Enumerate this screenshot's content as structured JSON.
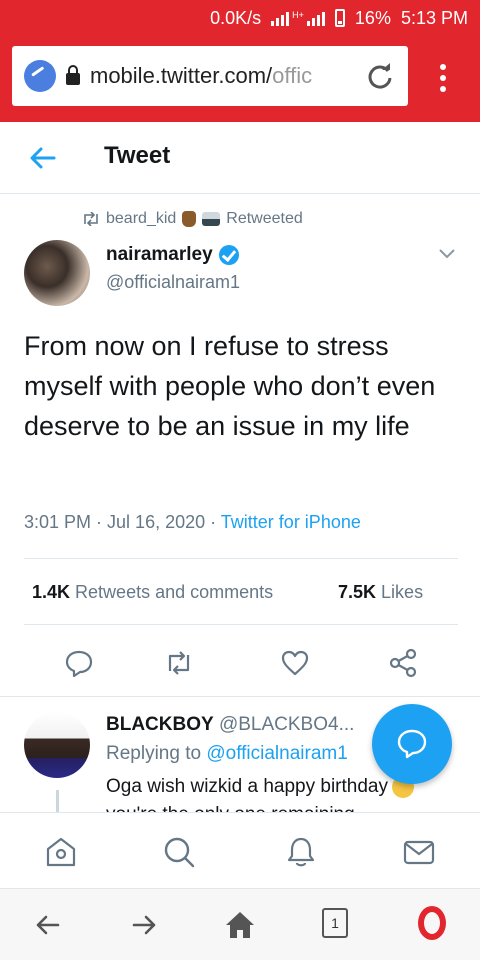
{
  "status_bar": {
    "network_speed": "0.0K/s",
    "network_type": "H+",
    "battery": "16%",
    "time": "5:13 PM"
  },
  "browser": {
    "url_main": "mobile.twitter.com/",
    "url_faded": "offic",
    "reload_icon": "reload-icon",
    "menu_icon": "kebab-menu-icon"
  },
  "header": {
    "title": "Tweet",
    "back_icon": "back-arrow-icon"
  },
  "tweet": {
    "retweeted_by": "beard_kid",
    "retweeted_label": "Retweeted",
    "author_name": "nairamarley",
    "author_handle": "@officialnairam1",
    "text": "From now on I refuse to stress myself with people who don’t even deserve to be an issue in my life",
    "time": "3:01 PM",
    "date": "Jul 16, 2020",
    "source": "Twitter for iPhone",
    "retweets_count": "1.4K",
    "retweets_label": "Retweets and comments",
    "likes_count": "7.5K",
    "likes_label": "Likes"
  },
  "reply": {
    "name": "BLACKBOY",
    "handle": "@BLACKBO4...",
    "replying_label": "Replying to",
    "replying_to": "@officialnairam1",
    "text": "Oga wish wizkid a happy birthday",
    "text_line2": "you're the only one remaining"
  },
  "colors": {
    "brand_red": "#e2262e",
    "twitter_blue": "#1da1f2",
    "muted_gray": "#657786"
  }
}
